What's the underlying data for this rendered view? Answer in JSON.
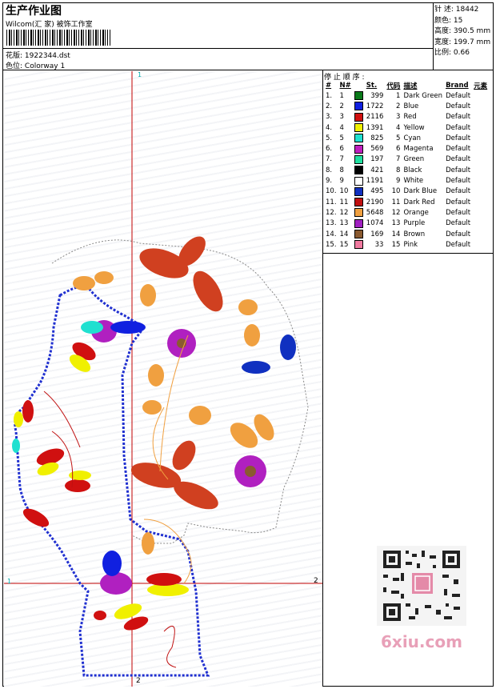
{
  "header": {
    "title": "生产作业图",
    "subtitle": "Wilcom(汇 家) 被饰工作室",
    "design_label": "花版:",
    "design_value": "1922344.dst",
    "colorway_label": "色位:",
    "colorway_value": "Colorway 1"
  },
  "stats": {
    "stitches_label": "针 述:",
    "stitches": "18442",
    "colors_label": "颜色:",
    "colors": "15",
    "height_label": "高度:",
    "height": "390.5 mm",
    "width_label": "宽度:",
    "width": "199.7 mm",
    "scale_label": "比例:",
    "scale": "0.66"
  },
  "stop_sequence_title": "停 止 顺 序 :",
  "table_headers": [
    "#",
    "N#",
    "St.",
    "代码",
    "描述",
    "Brand",
    "元素"
  ],
  "thread_rows": [
    {
      "idx": "1.",
      "n": "1",
      "st": "399",
      "code": "1",
      "desc": "Dark Green",
      "brand": "Default",
      "color": "#0a7a1a"
    },
    {
      "idx": "2.",
      "n": "2",
      "st": "1722",
      "code": "2",
      "desc": "Blue",
      "brand": "Default",
      "color": "#1020e0"
    },
    {
      "idx": "3.",
      "n": "3",
      "st": "2116",
      "code": "3",
      "desc": "Red",
      "brand": "Default",
      "color": "#d01010"
    },
    {
      "idx": "4.",
      "n": "4",
      "st": "1391",
      "code": "4",
      "desc": "Yellow",
      "brand": "Default",
      "color": "#f0f000"
    },
    {
      "idx": "5.",
      "n": "5",
      "st": "825",
      "code": "5",
      "desc": "Cyan",
      "brand": "Default",
      "color": "#20e0d0"
    },
    {
      "idx": "6.",
      "n": "6",
      "st": "569",
      "code": "6",
      "desc": "Magenta",
      "brand": "Default",
      "color": "#c020c0"
    },
    {
      "idx": "7.",
      "n": "7",
      "st": "197",
      "code": "7",
      "desc": "Green",
      "brand": "Default",
      "color": "#20e0a0"
    },
    {
      "idx": "8.",
      "n": "8",
      "st": "421",
      "code": "8",
      "desc": "Black",
      "brand": "Default",
      "color": "#000000"
    },
    {
      "idx": "9.",
      "n": "9",
      "st": "1191",
      "code": "9",
      "desc": "White",
      "brand": "Default",
      "color": "#ffffff"
    },
    {
      "idx": "10.",
      "n": "10",
      "st": "495",
      "code": "10",
      "desc": "Dark Blue",
      "brand": "Default",
      "color": "#1030c0"
    },
    {
      "idx": "11.",
      "n": "11",
      "st": "2190",
      "code": "11",
      "desc": "Dark Red",
      "brand": "Default",
      "color": "#c01010"
    },
    {
      "idx": "12.",
      "n": "12",
      "st": "5648",
      "code": "12",
      "desc": "Orange",
      "brand": "Default",
      "color": "#f0a040"
    },
    {
      "idx": "13.",
      "n": "13",
      "st": "1074",
      "code": "13",
      "desc": "Purple",
      "brand": "Default",
      "color": "#a020c0"
    },
    {
      "idx": "14.",
      "n": "14",
      "st": "169",
      "code": "14",
      "desc": "Brown",
      "brand": "Default",
      "color": "#8a5a30"
    },
    {
      "idx": "15.",
      "n": "15",
      "st": "33",
      "code": "15",
      "desc": "Pink",
      "brand": "Default",
      "color": "#f07aa0"
    }
  ],
  "axis_labels": {
    "top": "1",
    "bottom": "2",
    "left": "1",
    "right": "2"
  },
  "watermark": "6xiu.com"
}
